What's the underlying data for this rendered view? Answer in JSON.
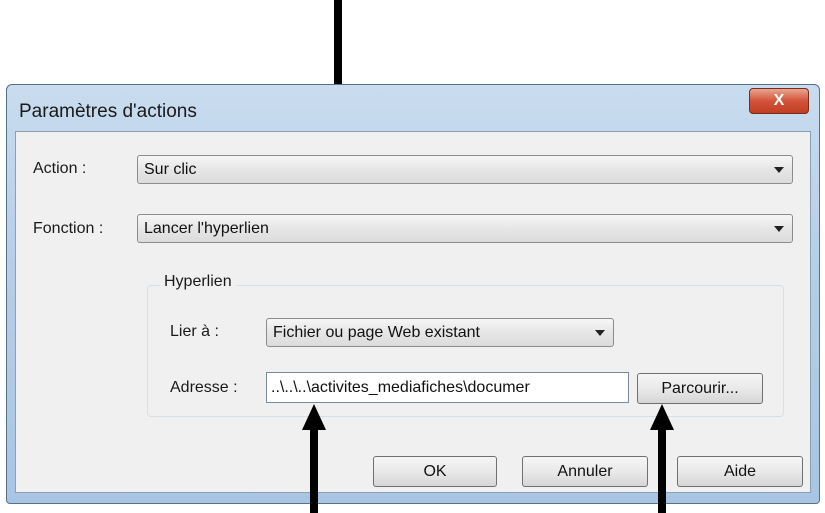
{
  "dialog": {
    "title": "Paramètres d'actions",
    "close_label": "X"
  },
  "action": {
    "label": "Action :",
    "value": "Sur clic"
  },
  "fonction": {
    "label": "Fonction :",
    "value": "Lancer l'hyperlien"
  },
  "hyperlien": {
    "group_title": "Hyperlien",
    "lier_label": "Lier à :",
    "lier_value": "Fichier ou page Web existant",
    "adresse_label": "Adresse :",
    "adresse_value": "..\\..\\..\\activites_mediafiches\\documer",
    "browse_label": "Parcourir..."
  },
  "buttons": {
    "ok": "OK",
    "cancel": "Annuler",
    "help": "Aide"
  }
}
